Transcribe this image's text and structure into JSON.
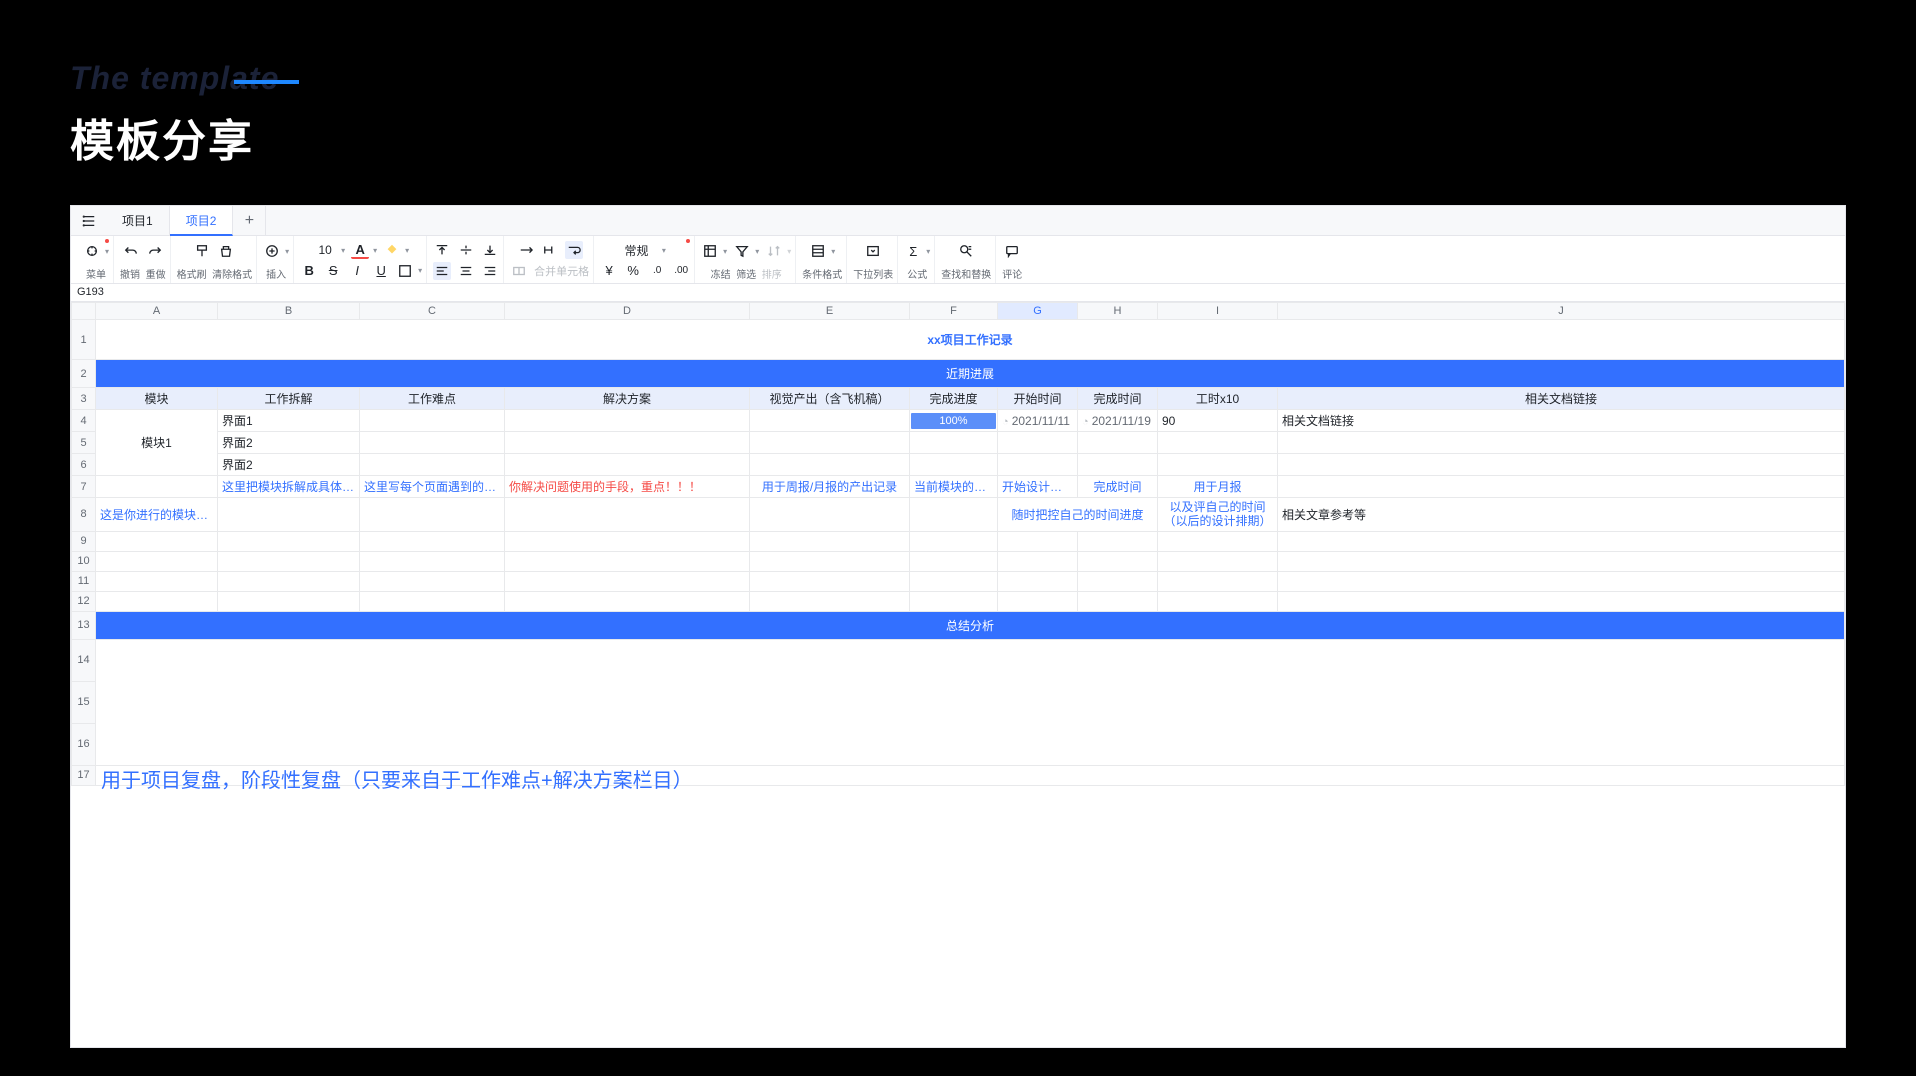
{
  "slide": {
    "subtitle": "The template",
    "title": "模板分享"
  },
  "tabs": {
    "items": [
      "项目1",
      "项目2"
    ],
    "activeIndex": 1,
    "addLabel": "+"
  },
  "toolbar": {
    "menu": "菜单",
    "undo": "撤销",
    "redo": "重做",
    "paintFormat": "格式刷",
    "clearFormat": "清除格式",
    "insert": "插入",
    "fontSize": "10",
    "freeze": "冻结",
    "filter": "筛选",
    "sort": "排序",
    "condFormat": "条件格式",
    "dropdown": "下拉列表",
    "formula": "公式",
    "findReplace": "查找和替换",
    "comment": "评论",
    "mergeCells": "合并单元格",
    "normal": "常规"
  },
  "cellRef": "G193",
  "columns": [
    "A",
    "B",
    "C",
    "D",
    "E",
    "F",
    "G",
    "H",
    "I",
    "J"
  ],
  "selectedCol": "G",
  "sheet": {
    "docTitle": "xx项目工作记录",
    "section1": "近期进展",
    "headers": {
      "module": "模块",
      "breakdown": "工作拆解",
      "difficulty": "工作难点",
      "solution": "解决方案",
      "visualOutput": "视觉产出（含飞机稿）",
      "progress": "完成进度",
      "startTime": "开始时间",
      "endTime": "完成时间",
      "hours": "工时x10",
      "docLink": "相关文档链接"
    },
    "module1Label": "模块1",
    "rows": [
      {
        "breakdown": "界面1",
        "progress": "100%",
        "start": "2021/11/11",
        "end": "2021/11/19",
        "hours": "90",
        "link": "相关文档链接"
      },
      {
        "breakdown": "界面2"
      },
      {
        "breakdown": "界面2"
      }
    ],
    "hints": {
      "a8": "这是你进行的模块设计",
      "b7": "这里把模块拆解成具体的页面",
      "c7": "这里写每个页面遇到的设计问题",
      "d7": "你解决问题使用的手段，重点！！！",
      "e7": "用于周报/月报的产出记录",
      "f7": "当前模块的进度表",
      "g7": "开始设计时间",
      "h7": "完成时间",
      "i7": "用于月报",
      "gh8": "随时把控自己的时间进度",
      "i8": "以及评自己的时间（以后的设计排期）",
      "j8": "相关文章参考等"
    },
    "section2": "总结分析",
    "summaryNote": "用于项目复盘，阶段性复盘（只要来自于工作难点+解决方案栏目）"
  }
}
